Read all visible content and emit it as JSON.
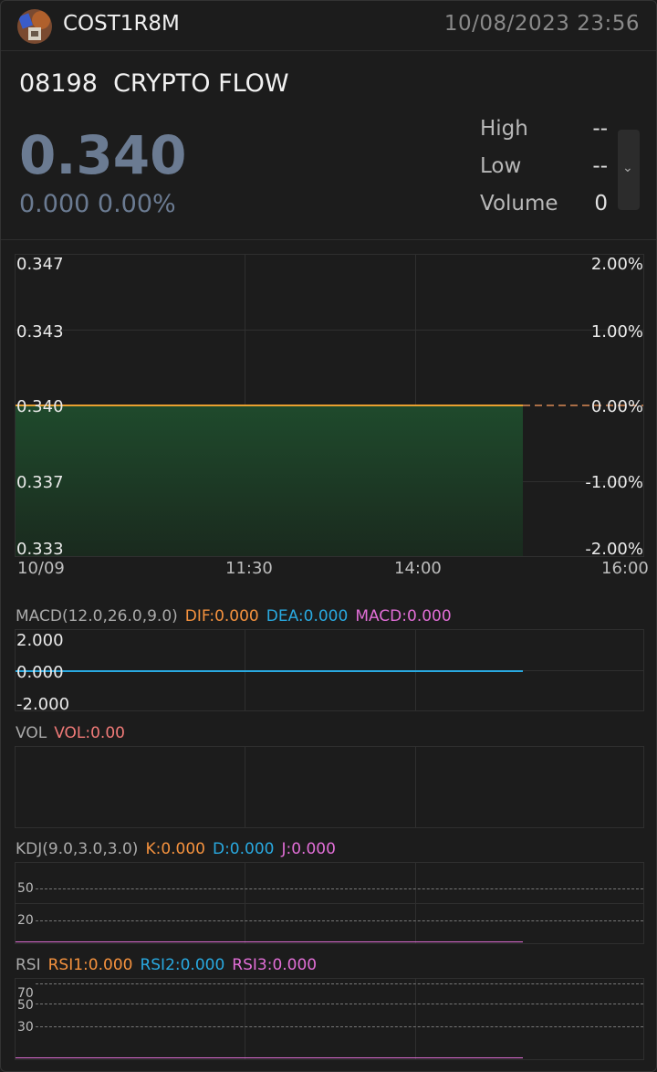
{
  "header": {
    "username": "COST1R8M",
    "datetime": "10/08/2023  23:56"
  },
  "quote": {
    "code": "08198",
    "name": "CRYPTO FLOW",
    "price": "0.340",
    "change": "0.000",
    "change_pct": "0.00%",
    "high_label": "High",
    "high_value": "--",
    "low_label": "Low",
    "low_value": "--",
    "volume_label": "Volume",
    "volume_value": "0"
  },
  "chart_data": {
    "type": "area",
    "price_axis": [
      "0.347",
      "0.343",
      "0.340",
      "0.337",
      "0.333"
    ],
    "pct_axis": [
      "2.00%",
      "1.00%",
      "0.00%",
      "-1.00%",
      "-2.00%"
    ],
    "x_ticks": [
      "10/09",
      "11:30",
      "14:00",
      "16:00"
    ],
    "prev_close": 0.34,
    "series": [
      {
        "values": [
          0.34,
          0.34
        ]
      }
    ],
    "ylim": [
      0.333,
      0.347
    ],
    "colors": {
      "line": "#e8a030",
      "fill": "#1f4a2c",
      "prev_close": "#d98a55"
    }
  },
  "indicators": {
    "macd": {
      "name": "MACD(12.0,26.0,9.0)",
      "dif": "DIF:0.000",
      "dea": "DEA:0.000",
      "macd": "MACD:0.000",
      "axis": [
        "2.000",
        "0.000",
        "-2.000"
      ]
    },
    "vol": {
      "name": "VOL",
      "vol": "VOL:0.00"
    },
    "kdj": {
      "name": "KDJ(9.0,3.0,3.0)",
      "k": "K:0.000",
      "d": "D:0.000",
      "j": "J:0.000",
      "levels": [
        "50",
        "20"
      ]
    },
    "rsi": {
      "name": "RSI",
      "rsi1": "RSI1:0.000",
      "rsi2": "RSI2:0.000",
      "rsi3": "RSI3:0.000",
      "levels": [
        "70",
        "50",
        "30"
      ]
    },
    "colors": {
      "orange": "#f5923e",
      "blue": "#29a9e0",
      "pink": "#e16ed6",
      "vol": "#f07a78"
    }
  }
}
